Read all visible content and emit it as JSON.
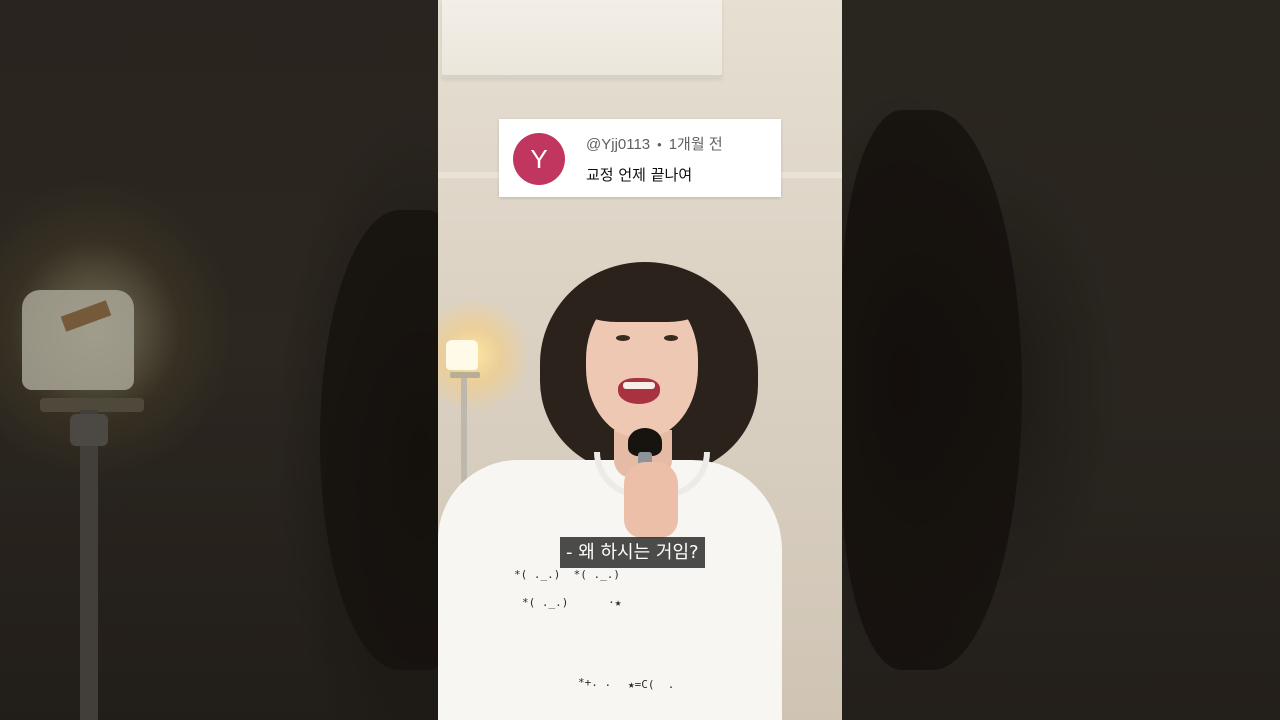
{
  "comment": {
    "avatar_letter": "Y",
    "avatar_color": "#c0365f",
    "username": "@Yjj0113",
    "separator": "•",
    "timestamp": "1개월 전",
    "text": "교정 언제 끝나여"
  },
  "subtitle": {
    "text": "- 왜 하시는 거임?"
  },
  "shirt_print": {
    "line1": "*( ._.)  *( ._.)",
    "line2": "*( ._.)      ·★",
    "line3": "★=C(  .",
    "line4": "*+. ."
  }
}
